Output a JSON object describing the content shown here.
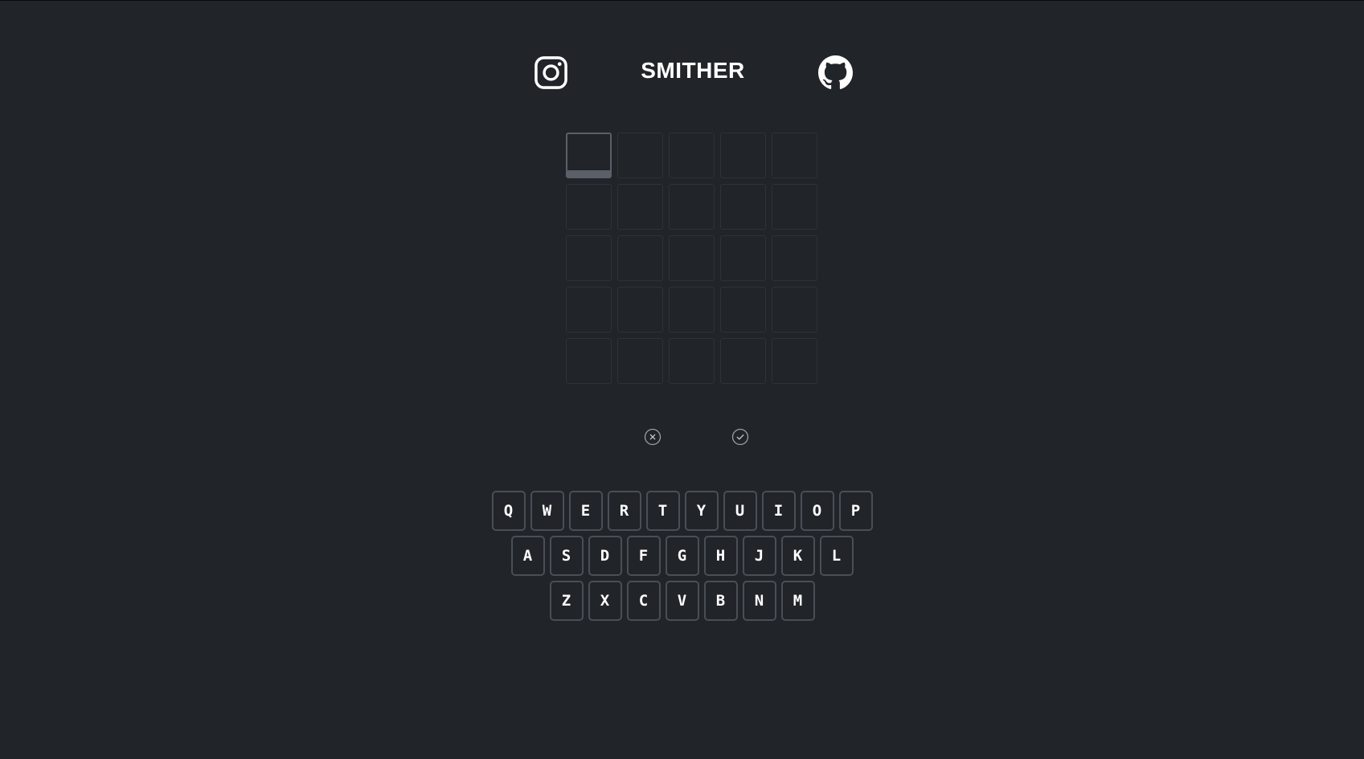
{
  "header": {
    "title": "SMITHER",
    "left_icon": "instagram-icon",
    "right_icon": "github-icon"
  },
  "board": {
    "rows": [
      [
        "",
        "",
        "",
        "",
        ""
      ],
      [
        "",
        "",
        "",
        "",
        ""
      ],
      [
        "",
        "",
        "",
        "",
        ""
      ],
      [
        "",
        "",
        "",
        "",
        ""
      ],
      [
        "",
        "",
        "",
        "",
        ""
      ]
    ],
    "active_row": 0,
    "active_col": 0
  },
  "controls": {
    "clear_icon": "close-circle-icon",
    "submit_icon": "check-circle-icon"
  },
  "keyboard": {
    "rows": [
      [
        "Q",
        "W",
        "E",
        "R",
        "T",
        "Y",
        "U",
        "I",
        "O",
        "P"
      ],
      [
        "A",
        "S",
        "D",
        "F",
        "G",
        "H",
        "J",
        "K",
        "L"
      ],
      [
        "Z",
        "X",
        "C",
        "V",
        "B",
        "N",
        "M"
      ]
    ]
  },
  "colors": {
    "background": "#212429",
    "tile_border": "#2e323a",
    "active_tile": "#5a5f68",
    "key_border": "#4a4e56",
    "text": "#ffffff"
  }
}
